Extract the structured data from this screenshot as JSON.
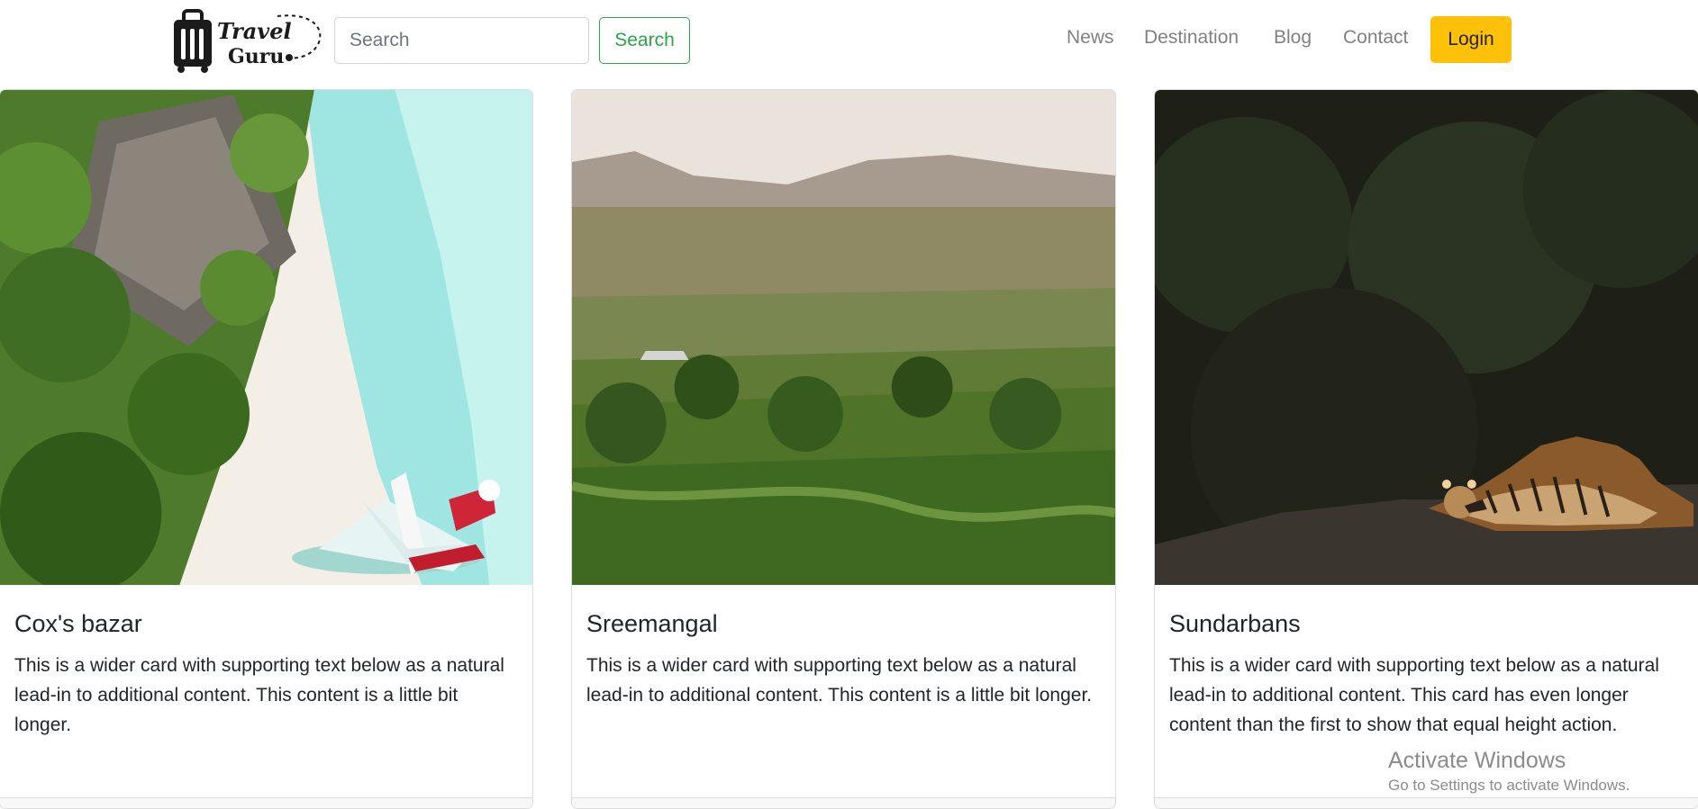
{
  "header": {
    "logo": {
      "line1": "Travel",
      "line2": "Guru"
    },
    "search": {
      "placeholder": "Search",
      "button_label": "Search"
    },
    "nav": [
      "News",
      "Destination",
      "Blog",
      "Contact"
    ],
    "login_label": "Login"
  },
  "cards": [
    {
      "title": "Cox's bazar",
      "text": "This is a wider card with supporting text below as a natural lead-in to additional content. This content is a little bit longer."
    },
    {
      "title": "Sreemangal",
      "text": "This is a wider card with supporting text below as a natural lead-in to additional content. This content is a little bit longer."
    },
    {
      "title": "Sundarbans",
      "text": "This is a wider card with supporting text below as a natural lead-in to additional content. This card has even longer content than the first to show that equal height action."
    }
  ],
  "watermark": {
    "title": "Activate Windows",
    "text": "Go to Settings to activate Windows."
  },
  "colors": {
    "accent_success": "#28a745",
    "accent_warning": "#ffc107",
    "nav_text": "#7f7f7f",
    "body_text": "#212529"
  }
}
